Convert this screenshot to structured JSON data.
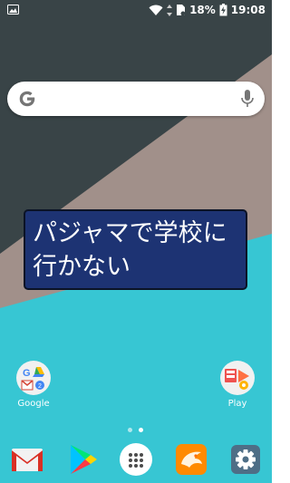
{
  "status_bar": {
    "battery_percent": "18%",
    "time": "19:08",
    "icons": [
      "gallery-notification-icon",
      "wifi-icon",
      "data-arrows-icon",
      "sim-icon",
      "battery-charging-icon"
    ]
  },
  "search": {
    "logo": "google-g-icon",
    "mic_icon": "mic-icon"
  },
  "note": {
    "text": "パジャマで学校に行かない"
  },
  "desktop_apps": [
    {
      "label": "Google",
      "icon": "google-folder-icon"
    },
    {
      "label": "Play",
      "icon": "play-folder-icon"
    }
  ],
  "page_indicator": {
    "pages": 2,
    "active": 1
  },
  "dock": [
    {
      "name": "gmail-icon"
    },
    {
      "name": "play-store-icon"
    },
    {
      "name": "app-drawer-icon"
    },
    {
      "name": "cm-browser-icon"
    },
    {
      "name": "settings-icon"
    }
  ],
  "colors": {
    "wallpaper_dark": "#394447",
    "wallpaper_tan": "#a1908a",
    "wallpaper_cyan": "#37c6d3",
    "note_bg": "#1d3373"
  }
}
